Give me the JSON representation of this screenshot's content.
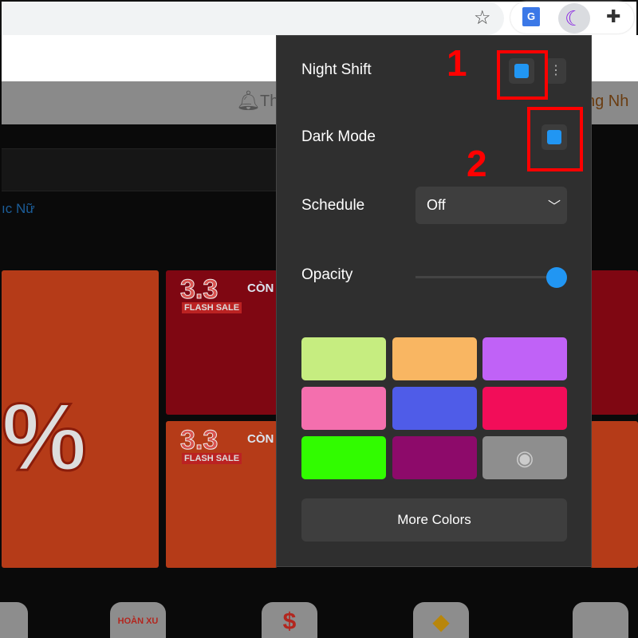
{
  "browser": {
    "star_icon": "star-icon",
    "extensions": [
      "google-translate-icon",
      "night-shift-moon-icon",
      "puzzle-icon"
    ]
  },
  "page": {
    "header_text_left": "Th",
    "header_text_right": "ng Nh",
    "category_link": "ıc Nữ",
    "banner_flash": "3.3",
    "banner_flash_label": "FLASH SALE",
    "banner_con": "CÒN",
    "percent": "%",
    "tile_label": "HOÀN XU"
  },
  "popup": {
    "night_shift": {
      "label": "Night Shift",
      "enabled": true
    },
    "dark_mode": {
      "label": "Dark Mode",
      "enabled": true
    },
    "schedule": {
      "label": "Schedule",
      "value": "Off"
    },
    "opacity": {
      "label": "Opacity",
      "value_percent": 100
    },
    "swatches": [
      "#c6ed80",
      "#f9b662",
      "#c062f7",
      "#f46fae",
      "#4f5ce8",
      "#f20d59",
      "#31fc00",
      "#8d0a6a",
      "#8e8e8e"
    ],
    "more_colors_label": "More Colors",
    "accent": "#2196f3"
  },
  "annotations": {
    "one": "1",
    "two": "2"
  }
}
